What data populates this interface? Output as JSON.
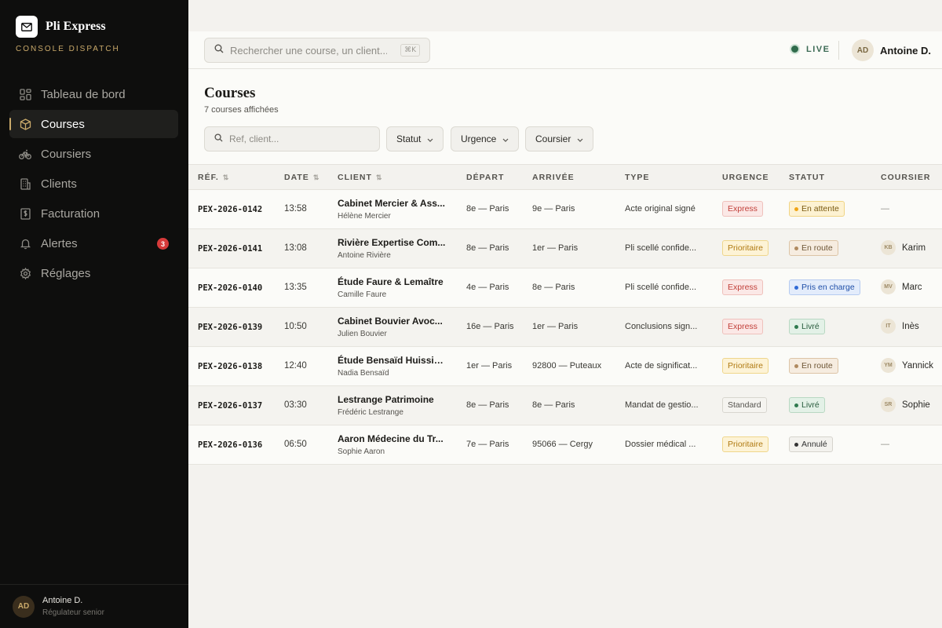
{
  "brand": {
    "name": "Pli Express",
    "subtitle": "CONSOLE DISPATCH"
  },
  "sidebar": {
    "items": [
      {
        "label": "Tableau de bord",
        "icon": "dashboard-icon",
        "active": false
      },
      {
        "label": "Courses",
        "icon": "package-icon",
        "active": true
      },
      {
        "label": "Coursiers",
        "icon": "bike-icon",
        "active": false
      },
      {
        "label": "Clients",
        "icon": "building-icon",
        "active": false
      },
      {
        "label": "Facturation",
        "icon": "invoice-icon",
        "active": false
      },
      {
        "label": "Alertes",
        "icon": "bell-icon",
        "active": false,
        "badge": "3"
      },
      {
        "label": "Réglages",
        "icon": "gear-icon",
        "active": false
      }
    ],
    "user": {
      "initials": "AD",
      "name": "Antoine D.",
      "role": "Régulateur senior"
    }
  },
  "topbar": {
    "search_placeholder": "Rechercher une course, un client...",
    "shortcut": "⌘K",
    "live_label": "LIVE",
    "user": {
      "initials": "AD",
      "name": "Antoine D."
    }
  },
  "page": {
    "title": "Courses",
    "subtitle": "7 courses affichées",
    "filter_placeholder": "Ref, client...",
    "filters": [
      "Statut",
      "Urgence",
      "Coursier"
    ]
  },
  "table": {
    "headers": {
      "ref": "RÉF.",
      "date": "DATE",
      "client": "CLIENT",
      "depart": "DÉPART",
      "arrivee": "ARRIVÉE",
      "type": "TYPE",
      "urgence": "URGENCE",
      "statut": "STATUT",
      "coursier": "COURSIER"
    },
    "rows": [
      {
        "ref": "PEX-2026-0142",
        "date": "13:58",
        "client": "Cabinet Mercier & Ass...",
        "contact": "Hélène Mercier",
        "depart": "8e — Paris",
        "arrivee": "9e — Paris",
        "type": "Acte original signé",
        "urgence": "Express",
        "statut": "En attente",
        "coursier_initials": "",
        "coursier": "—"
      },
      {
        "ref": "PEX-2026-0141",
        "date": "13:08",
        "client": "Rivière Expertise Com...",
        "contact": "Antoine Rivière",
        "depart": "8e — Paris",
        "arrivee": "1er — Paris",
        "type": "Pli scellé confide...",
        "urgence": "Prioritaire",
        "statut": "En route",
        "coursier_initials": "KB",
        "coursier": "Karim"
      },
      {
        "ref": "PEX-2026-0140",
        "date": "13:35",
        "client": "Étude Faure & Lemaître",
        "contact": "Camille Faure",
        "depart": "4e — Paris",
        "arrivee": "8e — Paris",
        "type": "Pli scellé confide...",
        "urgence": "Express",
        "statut": "Pris en charge",
        "coursier_initials": "MV",
        "coursier": "Marc"
      },
      {
        "ref": "PEX-2026-0139",
        "date": "10:50",
        "client": "Cabinet Bouvier Avoc...",
        "contact": "Julien Bouvier",
        "depart": "16e — Paris",
        "arrivee": "1er — Paris",
        "type": "Conclusions sign...",
        "urgence": "Express",
        "statut": "Livré",
        "coursier_initials": "IT",
        "coursier": "Inès"
      },
      {
        "ref": "PEX-2026-0138",
        "date": "12:40",
        "client": "Étude Bensaïd Huissiers",
        "contact": "Nadia Bensaïd",
        "depart": "1er — Paris",
        "arrivee": "92800 — Puteaux",
        "type": "Acte de significat...",
        "urgence": "Prioritaire",
        "statut": "En route",
        "coursier_initials": "YM",
        "coursier": "Yannick"
      },
      {
        "ref": "PEX-2026-0137",
        "date": "03:30",
        "client": "Lestrange Patrimoine",
        "contact": "Frédéric Lestrange",
        "depart": "8e — Paris",
        "arrivee": "8e — Paris",
        "type": "Mandat de gestio...",
        "urgence": "Standard",
        "statut": "Livré",
        "coursier_initials": "SR",
        "coursier": "Sophie"
      },
      {
        "ref": "PEX-2026-0136",
        "date": "06:50",
        "client": "Aaron Médecine du Tr...",
        "contact": "Sophie Aaron",
        "depart": "7e — Paris",
        "arrivee": "95066 — Cergy",
        "type": "Dossier médical ...",
        "urgence": "Prioritaire",
        "statut": "Annulé",
        "coursier_initials": "",
        "coursier": "—"
      }
    ]
  },
  "colors": {
    "accent_gold": "#c9a96a",
    "express": "#c2403a",
    "prioritaire": "#b07a12",
    "standard": "#55534e",
    "en_attente": "#f0a516",
    "en_route": "#b08a60",
    "pris_en_charge": "#2f6ad6",
    "livre": "#2f7a4f",
    "annule": "#333333",
    "alert_badge": "#d63a3a"
  }
}
